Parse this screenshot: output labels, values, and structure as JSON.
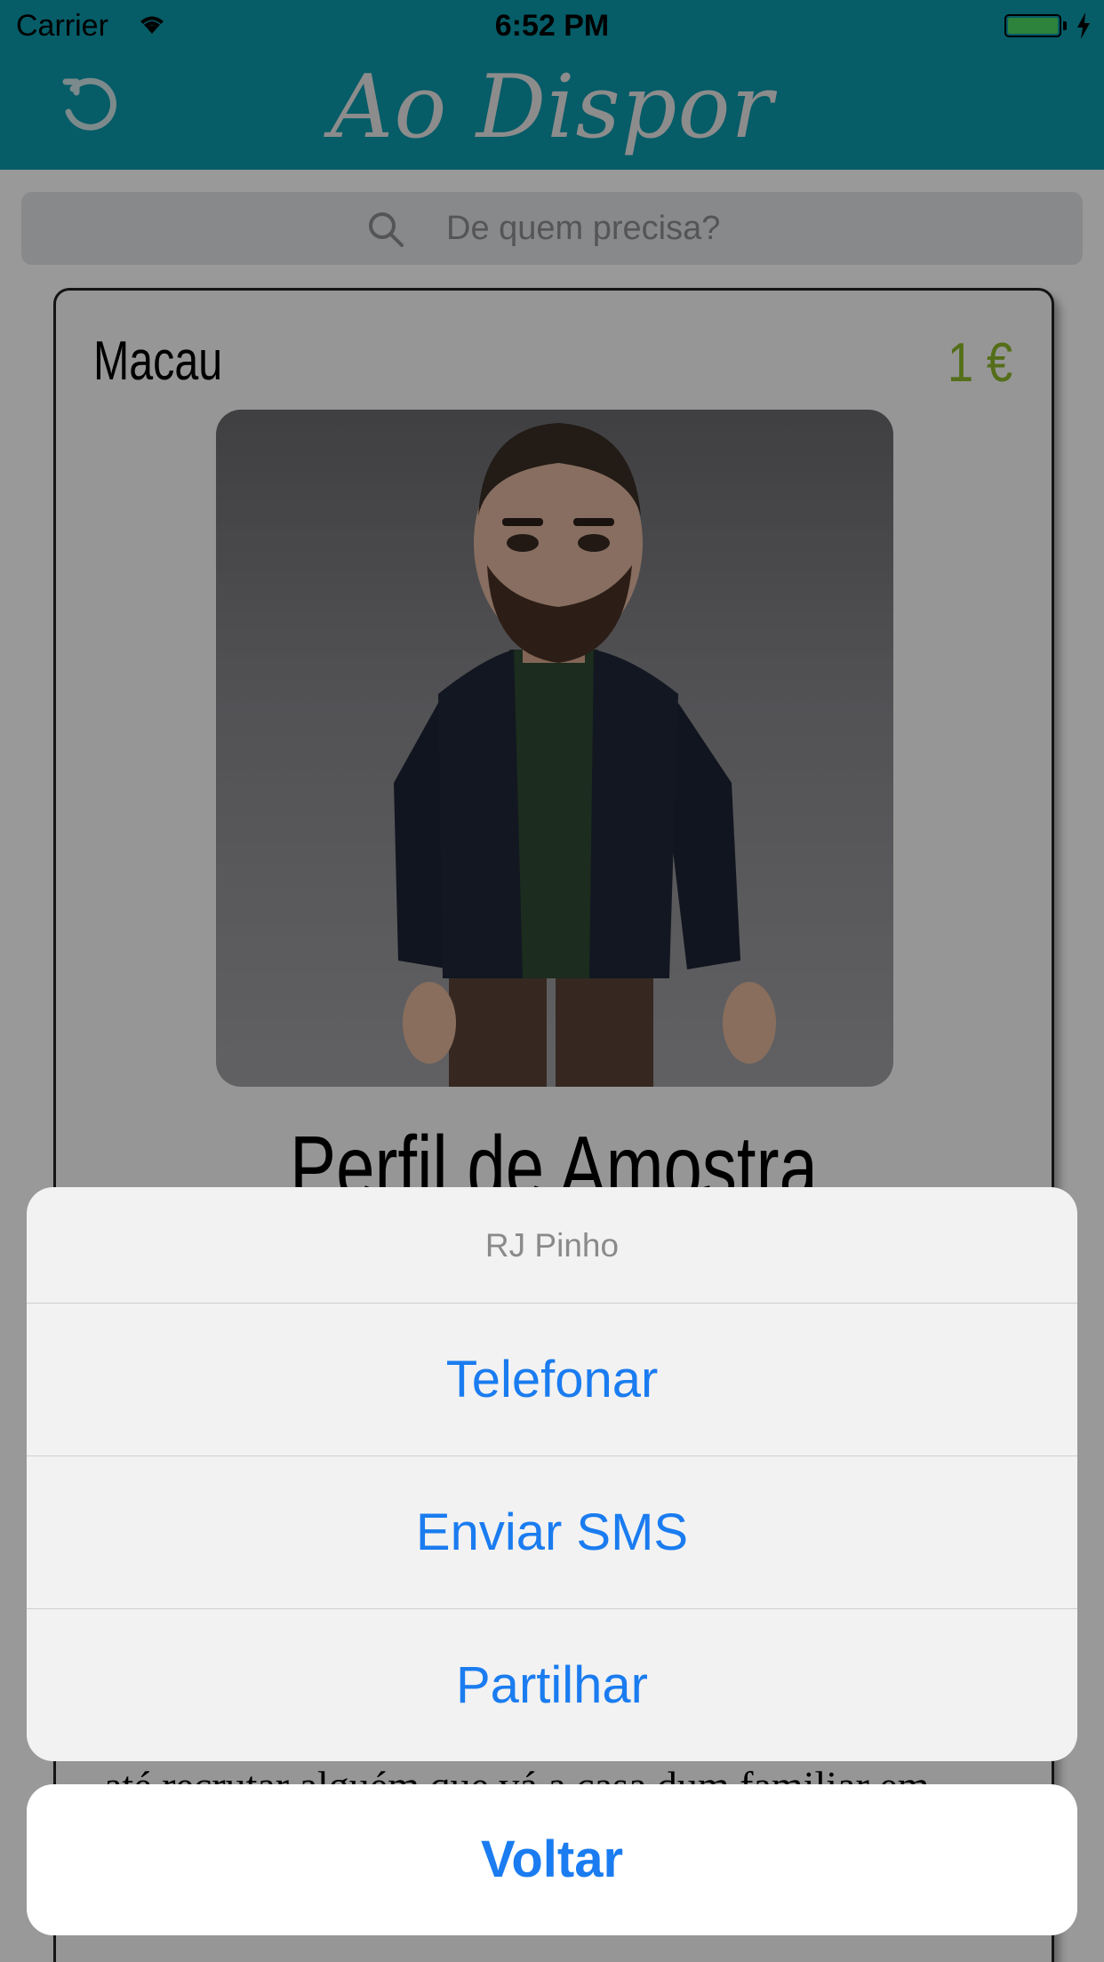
{
  "status_bar": {
    "carrier": "Carrier",
    "time": "6:52 PM",
    "battery_color": "#4cd964"
  },
  "nav": {
    "title": "Ao Dispor",
    "refresh_icon": "refresh-icon",
    "bar_color": "#0a99ac"
  },
  "search": {
    "placeholder": "De quem precisa?",
    "icon": "search-icon"
  },
  "card": {
    "city": "Macau",
    "price": "1 €",
    "profile_name": "Perfil de Amostra",
    "description": "até recrutar alguém que vá a casa dum familiar em",
    "price_color": "#8db82b"
  },
  "action_sheet": {
    "title": "RJ Pinho",
    "actions": [
      {
        "label": "Telefonar"
      },
      {
        "label": "Enviar SMS"
      },
      {
        "label": "Partilhar"
      }
    ],
    "cancel_label": "Voltar",
    "action_color": "#1a7cf0"
  }
}
